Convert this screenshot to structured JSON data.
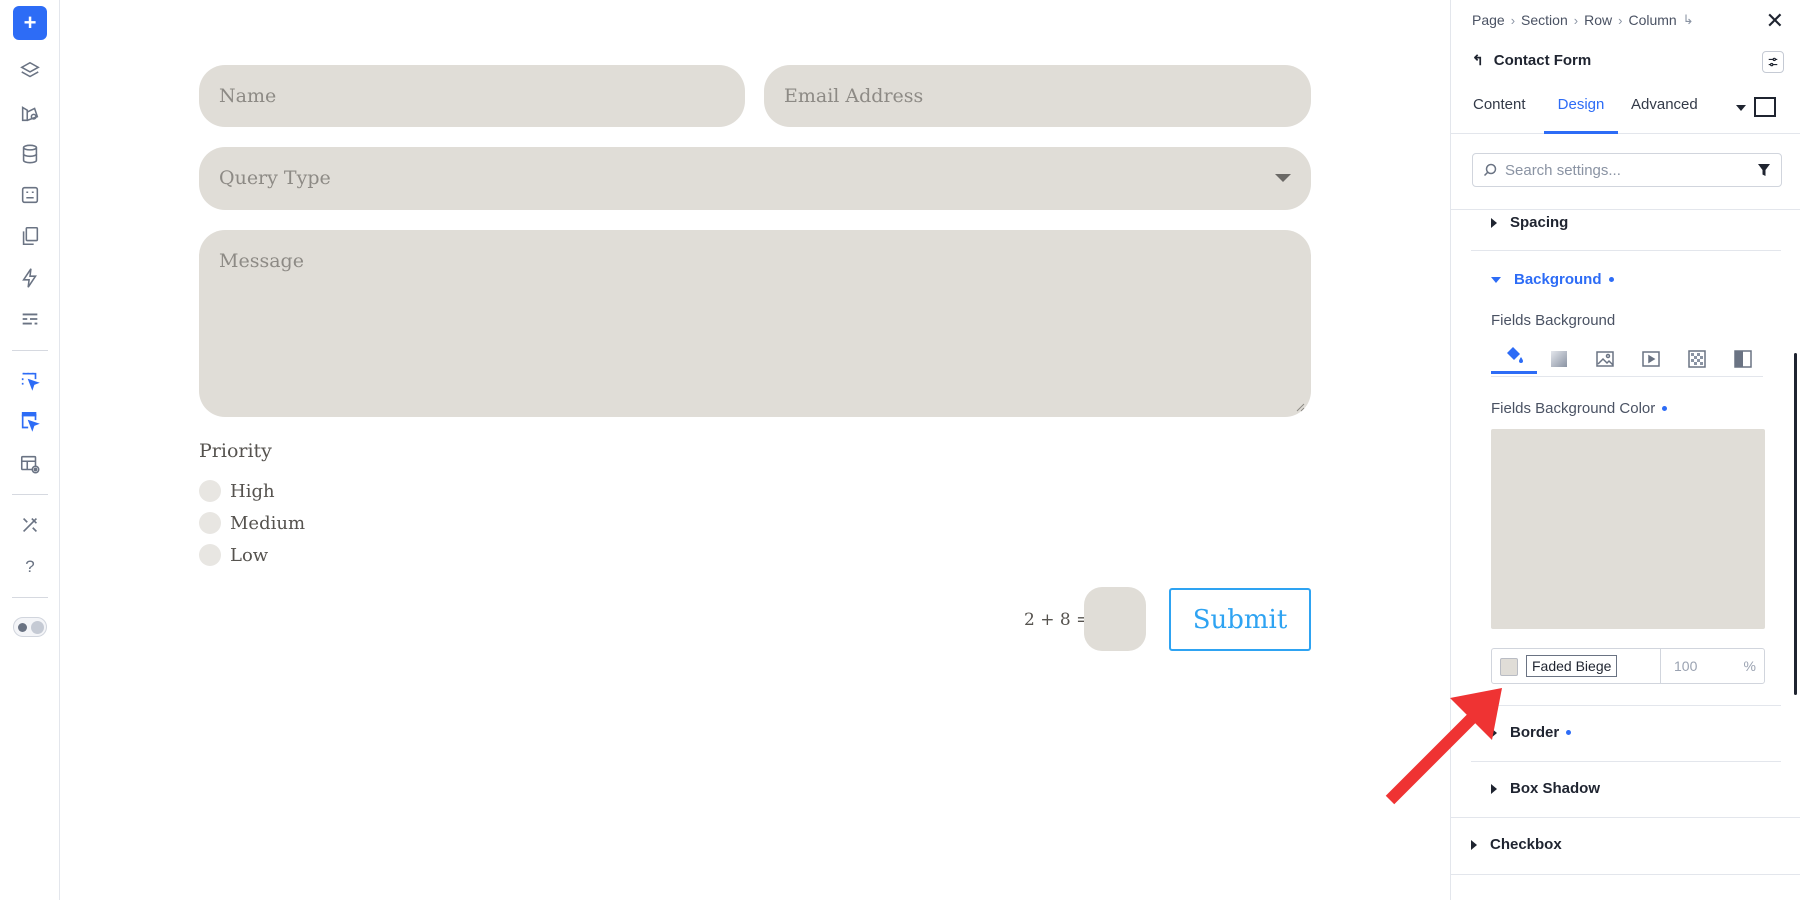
{
  "toolbar": {
    "items": [
      "add-icon",
      "layers-icon",
      "theme-builder-icon",
      "database-icon",
      "form-icon",
      "pages-icon",
      "lightning-icon",
      "list-icon",
      "select-element-icon",
      "select-element-alt-icon",
      "template-preview-icon",
      "tools-icon",
      "help-icon",
      "theme-toggle-icon"
    ],
    "add_label": "+",
    "help_label": "?"
  },
  "form": {
    "name_placeholder": "Name",
    "email_placeholder": "Email Address",
    "query_placeholder": "Query Type",
    "message_placeholder": "Message",
    "priority_label": "Priority",
    "priority_options": [
      "High",
      "Medium",
      "Low"
    ],
    "captcha": "2 + 8 =",
    "submit_label": "Submit",
    "field_background": "#e0ddd7",
    "submit_color": "#2ea3f2"
  },
  "panel": {
    "breadcrumb": [
      "Page",
      "Section",
      "Row",
      "Column"
    ],
    "breadcrumb_sep": "›",
    "breadcrumb_end": "↳",
    "close": "✕",
    "back": "↰",
    "title": "Contact Form",
    "tabs": [
      "Content",
      "Design",
      "Advanced"
    ],
    "active_tab": "Design",
    "search_placeholder": "Search settings...",
    "sections": {
      "spacing": "Spacing",
      "background": "Background",
      "border": "Border",
      "box_shadow": "Box Shadow",
      "checkbox": "Checkbox"
    },
    "fields_background_label": "Fields Background",
    "bg_tab_icons": [
      "paint-bucket-icon",
      "gradient-icon",
      "image-icon",
      "video-icon",
      "pattern-icon",
      "mask-icon"
    ],
    "fields_background_color_label": "Fields Background Color",
    "color_name": "Faded Biege",
    "opacity_value": "100",
    "opacity_unit": "%",
    "accent_color": "#2d6cf6"
  }
}
